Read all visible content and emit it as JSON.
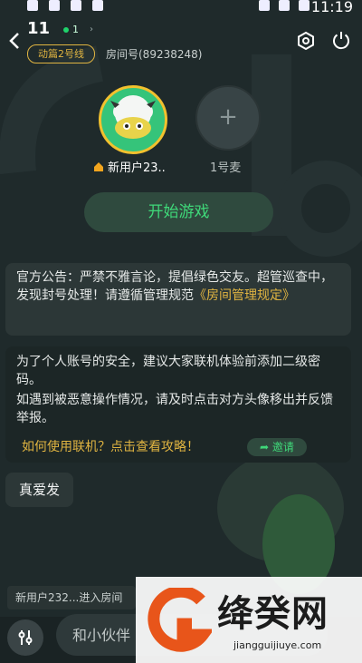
{
  "statusbar": {
    "time": "11:19"
  },
  "header": {
    "room_name": "11",
    "online_count": "1",
    "line_badge": "动篇2号线",
    "room_id": "房间号(89238248)"
  },
  "seats": [
    {
      "name": "新用户23..",
      "occupied": true
    },
    {
      "name": "1号麦",
      "occupied": false
    }
  ],
  "start_button": "开始游戏",
  "notice": {
    "text": "官方公告：严禁不雅言论，提倡绿色交友。超管巡查中，发现封号处理！请遵循管理规范",
    "link": "《房间管理规定》"
  },
  "tip": {
    "line1": "为了个人账号的安全，建议大家联机体验前添加二级密码。",
    "line2": "如遇到被恶意操作情况，请及时点击对方头像移出并反馈举报。",
    "guide": "如何使用联机？点击查看攻略！",
    "invite": "邀请"
  },
  "chat": {
    "message": "真爱发"
  },
  "join_notice": "新用户232...进入房间",
  "input": {
    "placeholder": "和小伙伴"
  },
  "watermark": {
    "title": "绛癸网",
    "url": "jiangguijiuye.com"
  },
  "colors": {
    "accent_green": "#3fd879",
    "accent_gold": "#e0b441",
    "background": "#1f2a2b"
  }
}
